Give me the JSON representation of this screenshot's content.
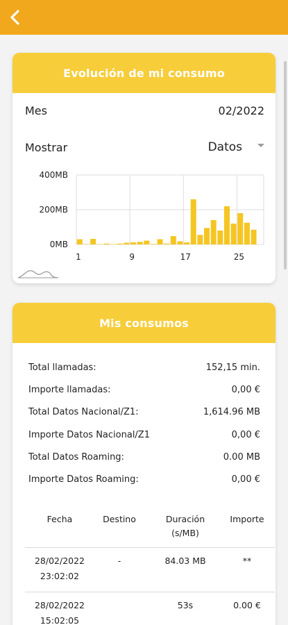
{
  "colors": {
    "header_orange": "#f2a81d",
    "card_yellow": "#f7cd3a",
    "bar_yellow": "#f5c623"
  },
  "icons": {
    "back": "chevron-left-icon",
    "logo": "wave-logo-icon",
    "dropdown": "caret-down-icon"
  },
  "chart_section": {
    "title": "Evolución de mi consumo",
    "month_label": "Mes",
    "month_value": "02/2022",
    "show_label": "Mostrar",
    "show_value": "Datos"
  },
  "chart_data": {
    "type": "bar",
    "y_ticks": [
      "400MB",
      "200MB",
      "0MB"
    ],
    "ylim": [
      0,
      400
    ],
    "x_ticks": [
      "1",
      "9",
      "17",
      "25"
    ],
    "days": [
      1,
      2,
      3,
      4,
      5,
      6,
      7,
      8,
      9,
      10,
      11,
      12,
      13,
      14,
      15,
      16,
      17,
      18,
      19,
      20,
      21,
      22,
      23,
      24,
      25,
      26,
      27,
      28
    ],
    "values": [
      30,
      2,
      32,
      2,
      5,
      2,
      5,
      10,
      12,
      15,
      22,
      3,
      30,
      5,
      48,
      18,
      12,
      260,
      55,
      95,
      140,
      80,
      220,
      120,
      180,
      125,
      85,
      0
    ],
    "grid": true
  },
  "consumos": {
    "title": "Mis consumos",
    "stats": [
      {
        "label": "Total llamadas:",
        "value": "152,15 min."
      },
      {
        "label": "Importe llamadas:",
        "value": "0,00 €"
      },
      {
        "label": "Total Datos Nacional/Z1:",
        "value": "1,614.96 MB"
      },
      {
        "label": "Importe Datos Nacional/Z1",
        "value": "0,00 €"
      },
      {
        "label": "Total Datos Roaming:",
        "value": "0.00 MB"
      },
      {
        "label": "Importe Datos Roaming:",
        "value": "0,00 €"
      }
    ],
    "table": {
      "headers": {
        "fecha": "Fecha",
        "destino": "Destino",
        "duracion": "Duración (s/MB)",
        "importe": "Importe"
      },
      "rows": [
        {
          "fecha": "28/02/2022",
          "hora": "23:02:02",
          "destino": "-",
          "duracion": "84.03 MB",
          "importe": "**"
        },
        {
          "fecha": "28/02/2022",
          "hora": "15:02:05",
          "destino": "",
          "duracion": "53s",
          "importe": "0.00 €"
        }
      ]
    }
  }
}
